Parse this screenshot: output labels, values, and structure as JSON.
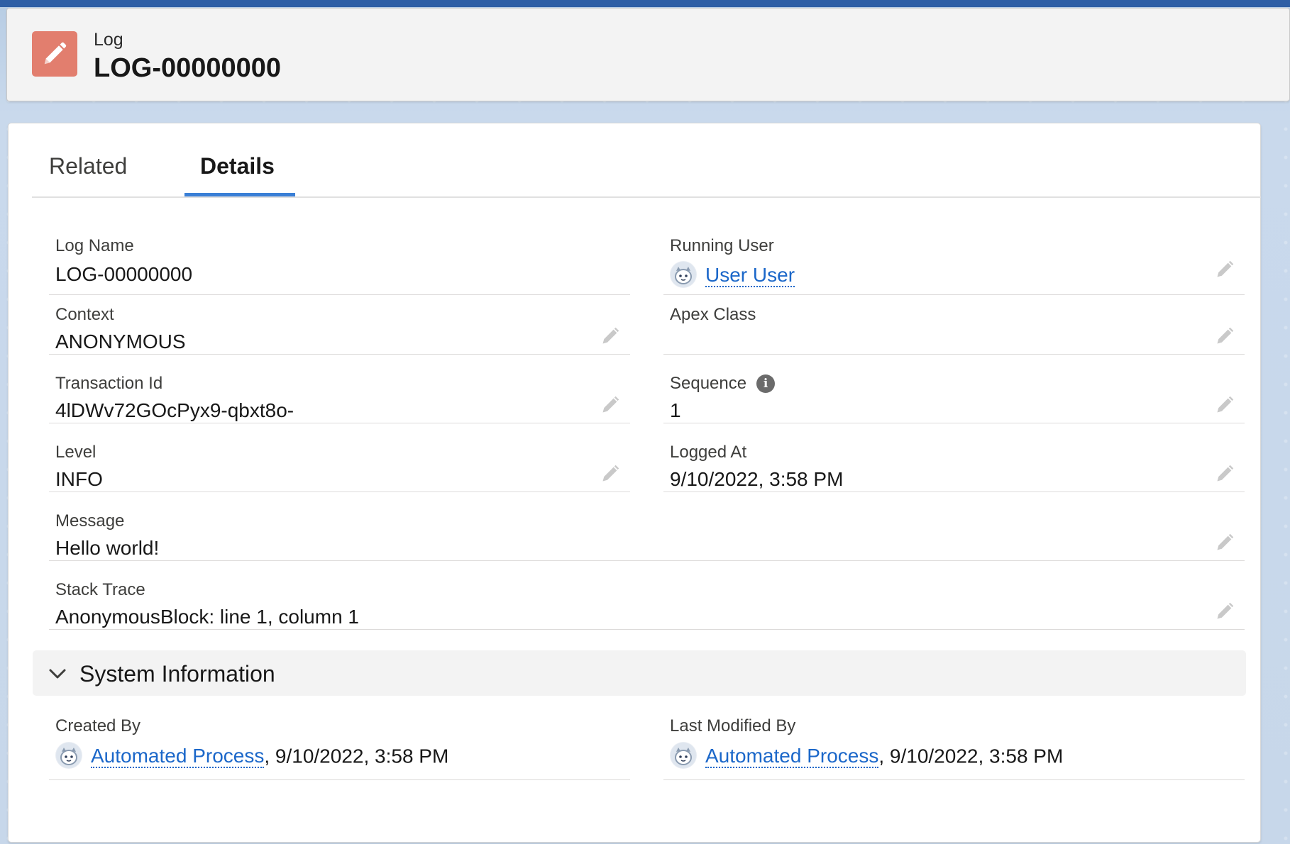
{
  "header": {
    "object_label": "Log",
    "record_title": "LOG-00000000"
  },
  "tabs": [
    {
      "label": "Related",
      "selected": false
    },
    {
      "label": "Details",
      "selected": true
    }
  ],
  "fields": {
    "log_name": {
      "label": "Log Name",
      "value": "LOG-00000000"
    },
    "running_user": {
      "label": "Running User",
      "value": "User User"
    },
    "context": {
      "label": "Context",
      "value": "ANONYMOUS"
    },
    "apex_class": {
      "label": "Apex Class",
      "value": ""
    },
    "transaction_id": {
      "label": "Transaction Id",
      "value": "4lDWv72GOcPyx9-qbxt8o-"
    },
    "sequence": {
      "label": "Sequence",
      "value": "1",
      "info_icon": "i"
    },
    "level": {
      "label": "Level",
      "value": "INFO"
    },
    "logged_at": {
      "label": "Logged At",
      "value": "9/10/2022, 3:58 PM"
    },
    "message": {
      "label": "Message",
      "value": "Hello world!"
    },
    "stack_trace": {
      "label": "Stack Trace",
      "value": "AnonymousBlock: line 1, column 1"
    }
  },
  "system_information": {
    "title": "System Information",
    "created_by": {
      "label": "Created By",
      "user": "Automated Process",
      "date": ", 9/10/2022, 3:58 PM"
    },
    "last_modified_by": {
      "label": "Last Modified By",
      "user": "Automated Process",
      "date": ", 9/10/2022, 3:58 PM"
    }
  },
  "colors": {
    "brand_header": "#2f5fa5",
    "record_icon": "#e27e6e",
    "link": "#1b67c9",
    "tab_underline": "#3a7fd6"
  },
  "icons": {
    "record_icon": "pencil-icon",
    "edit": "pencil-edit-icon",
    "avatar": "astro-avatar-icon",
    "section_toggle": "chevron-down-icon",
    "info": "info-icon"
  }
}
